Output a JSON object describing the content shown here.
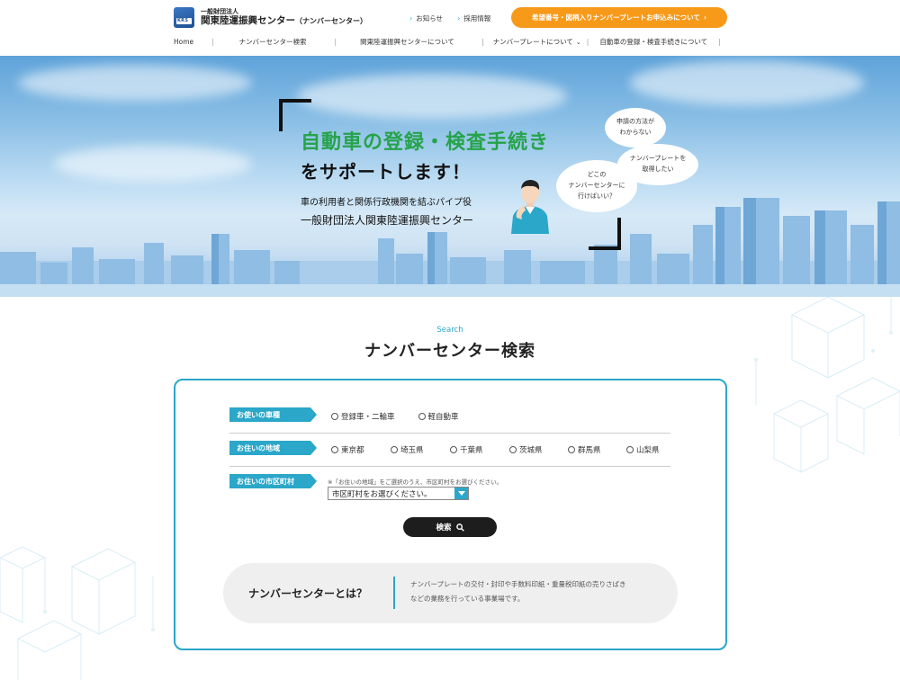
{
  "header": {
    "org_sub": "一般財団法人",
    "org_name": "関東陸運振興センター",
    "org_paren": "（ナンバーセンター）",
    "logo_text": "KRS",
    "top_links": [
      "お知らせ",
      "採用情報"
    ],
    "cta_label": "希望番号・図柄入りナンバープレートお申込みについて",
    "nav": [
      {
        "label": "Home"
      },
      {
        "label": "ナンバーセンター検索"
      },
      {
        "label": "関東陸運振興センターについて"
      },
      {
        "label": "ナンバープレートについて"
      },
      {
        "label": "自動車の登録・検査手続きについて"
      }
    ]
  },
  "hero": {
    "title_line1": "自動車の登録・検査手続き",
    "title_line2": "をサポートします！",
    "sub_line1": "車の利用者と関係行政機関を結ぶパイプ役",
    "sub_line2": "一般財団法人関東陸運振興センター",
    "bubbles": [
      [
        "申請の方法が",
        "わからない"
      ],
      [
        "ナンバープレートを",
        "取得したい"
      ],
      [
        "どこの",
        "ナンバーセンターに",
        "行けばいい？"
      ]
    ]
  },
  "search": {
    "label_en": "Search",
    "title": "ナンバーセンター検索",
    "vehicle_label": "お使いの車種",
    "vehicle_options": [
      "登録車・二輪車",
      "軽自動車"
    ],
    "region_label": "お住いの地域",
    "region_options": [
      "東京都",
      "埼玉県",
      "千葉県",
      "茨城県",
      "群馬県",
      "山梨県"
    ],
    "city_label": "お住いの市区町村",
    "city_note": "※「お住いの地域」をご選択のうえ、市区町村をお選びください。",
    "city_select_value": "市区町村をお選びください。",
    "button_label": "検索"
  },
  "about": {
    "title": "ナンバーセンターとは？",
    "text_line1": "ナンバープレートの交付・封印や手数料印紙・重量税印紙の売りさばき",
    "text_line2": "などの業務を行っている事業場です。"
  },
  "colors": {
    "accent": "#2aa7c9",
    "cta": "#f79a1a",
    "hero_green": "#26a34a",
    "button_dark": "#1d1d1d"
  }
}
